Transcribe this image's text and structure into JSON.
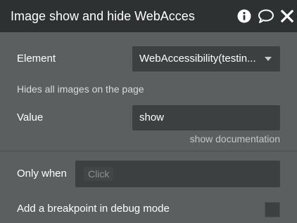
{
  "header": {
    "title": "Image show and hide WebAcces"
  },
  "icons": {
    "info": "info-icon",
    "chat": "chat-icon",
    "close": "close-icon"
  },
  "fields": {
    "element_label": "Element",
    "element_value": "WebAccessibility(testin...",
    "description": "Hides all images on the page",
    "value_label": "Value",
    "value_value": "show",
    "doc_link": "show documentation"
  },
  "conditions": {
    "only_when_label": "Only when",
    "click_placeholder": "Click",
    "breakpoint_label": "Add a breakpoint in debug mode",
    "breakpoint_checked": false
  },
  "colors": {
    "header_bg": "#2e3131",
    "panel_bg": "#5c5f60",
    "input_bg": "#3d4041"
  }
}
